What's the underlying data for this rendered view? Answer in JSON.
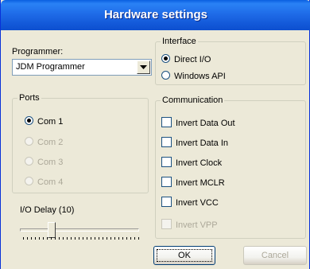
{
  "window": {
    "title": "Hardware settings"
  },
  "programmer": {
    "label": "Programmer:",
    "selected": "JDM Programmer"
  },
  "interface": {
    "legend": "Interface",
    "options": [
      {
        "label": "Direct I/O",
        "checked": true
      },
      {
        "label": "Windows API",
        "checked": false
      }
    ]
  },
  "ports": {
    "legend": "Ports",
    "options": [
      {
        "label": "Com 1",
        "checked": true,
        "enabled": true
      },
      {
        "label": "Com 2",
        "checked": false,
        "enabled": false
      },
      {
        "label": "Com 3",
        "checked": false,
        "enabled": false
      },
      {
        "label": "Com 4",
        "checked": false,
        "enabled": false
      }
    ]
  },
  "communication": {
    "legend": "Communication",
    "options": [
      {
        "label": "Invert Data Out",
        "checked": false,
        "enabled": true
      },
      {
        "label": "Invert Data In",
        "checked": false,
        "enabled": true
      },
      {
        "label": "Invert Clock",
        "checked": false,
        "enabled": true
      },
      {
        "label": "Invert MCLR",
        "checked": false,
        "enabled": true
      },
      {
        "label": "Invert VCC",
        "checked": false,
        "enabled": true
      },
      {
        "label": "Invert VPP",
        "checked": false,
        "enabled": false
      }
    ]
  },
  "io_delay": {
    "label": "I/O Delay (10)",
    "value": 10
  },
  "buttons": {
    "ok": "OK",
    "cancel": "Cancel"
  },
  "colors": {
    "titlebar": "#1f6ce8",
    "dialog_bg": "#ece9d8",
    "disabled_text": "#aca899"
  }
}
